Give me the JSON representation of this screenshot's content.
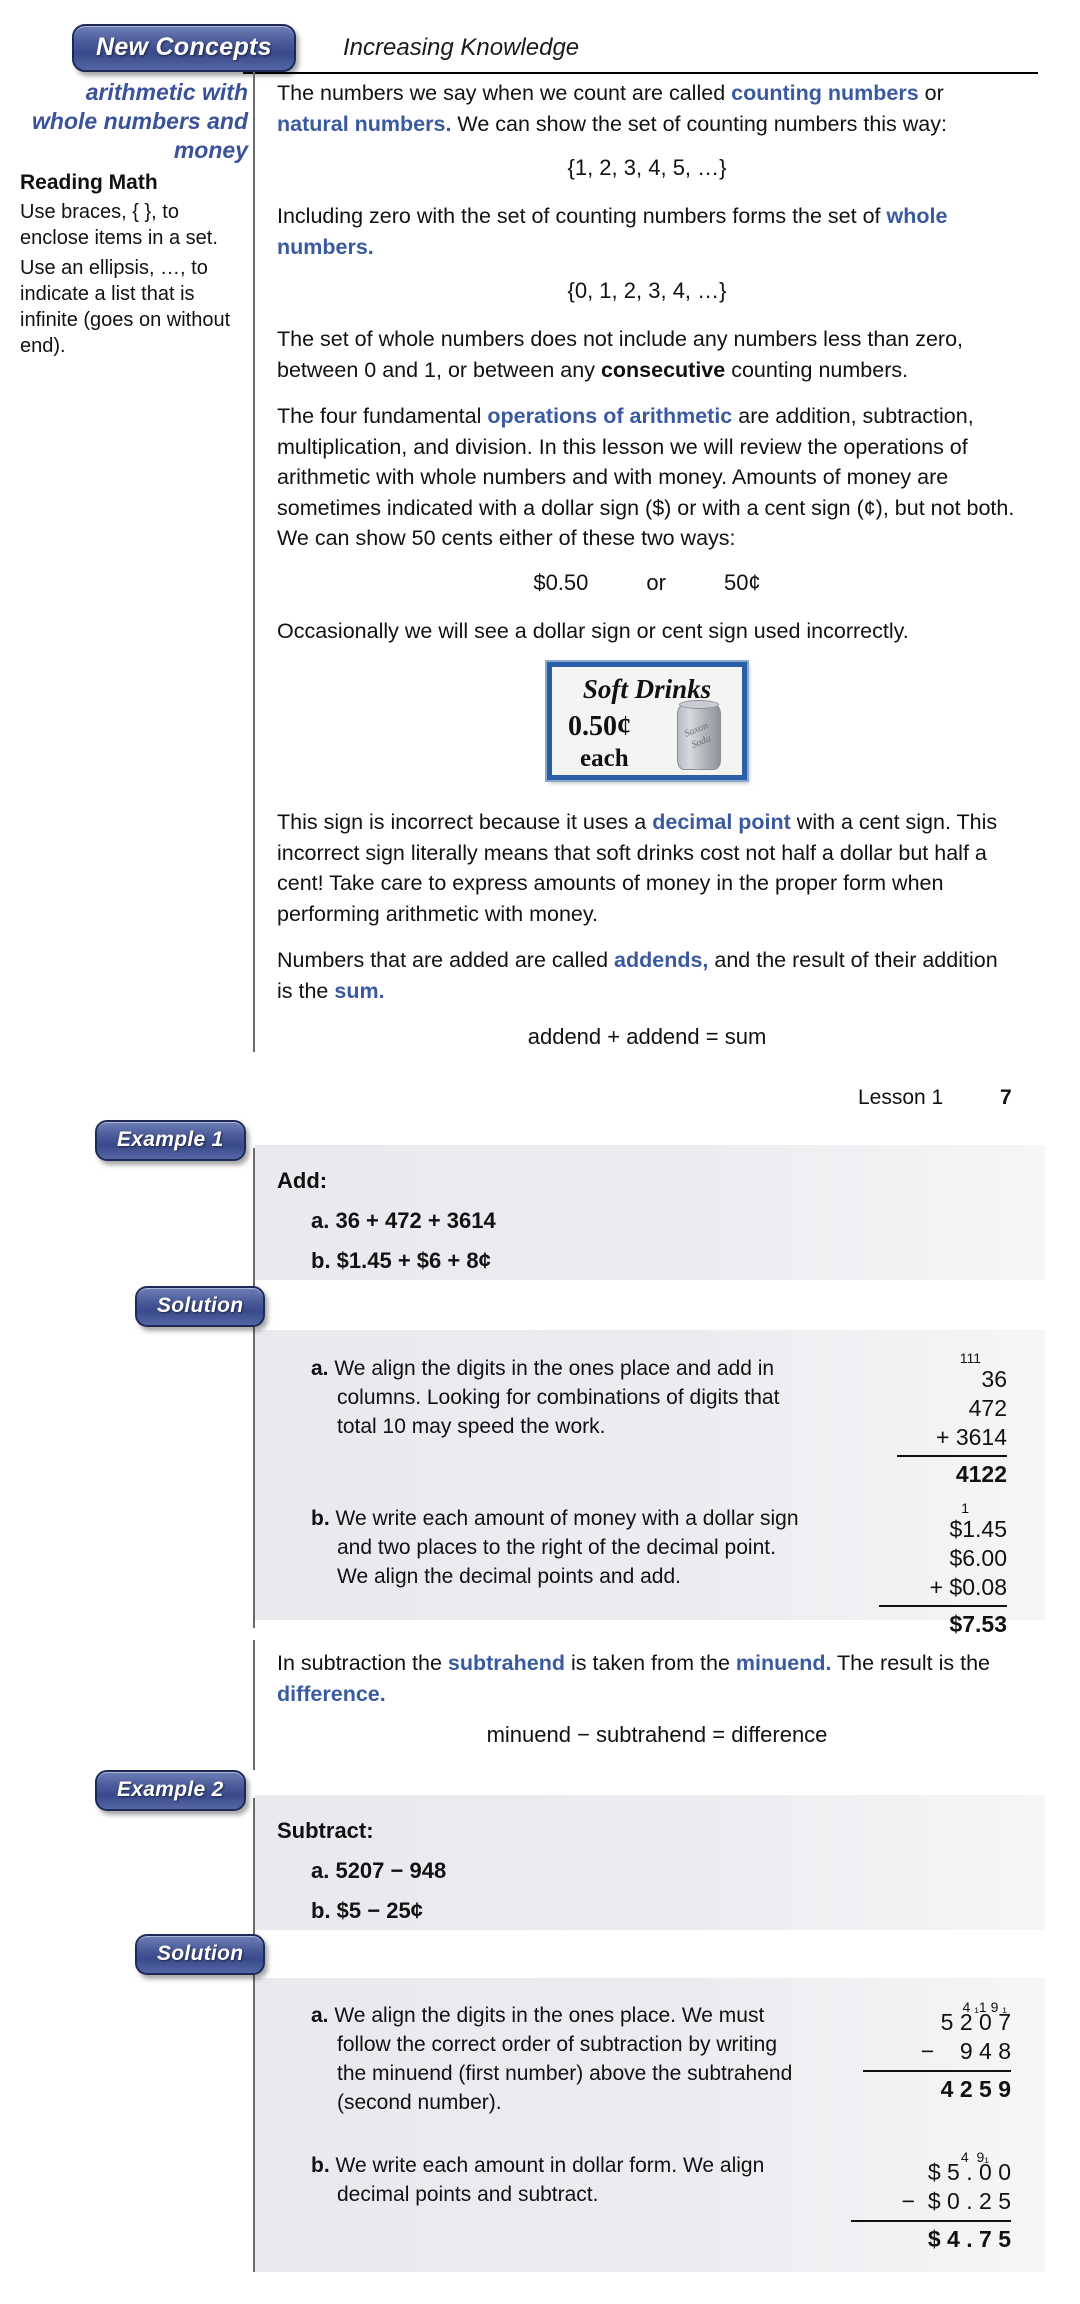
{
  "header": {
    "tab_label": "New Concepts",
    "subtitle": "Increasing Knowledge"
  },
  "sidebar": {
    "topic": "arithmetic with whole numbers and money",
    "reading_math_heading": "Reading Math",
    "reading_math_paragraphs": [
      "Use braces, { }, to enclose items in a set.",
      "Use an ellipsis, …, to indicate a list that is infinite (goes on without end)."
    ]
  },
  "body": {
    "p1_a": "The numbers we say when we count are called ",
    "p1_kw1": "counting numbers",
    "p1_b": " or ",
    "p1_kw2": "natural numbers.",
    "p1_c": " We can show the set of counting numbers this way:",
    "set_counting": "{1, 2, 3, 4, 5, …}",
    "p2_a": "Including zero with the set of counting numbers forms the set of ",
    "p2_kw": "whole numbers.",
    "set_whole": "{0, 1, 2, 3, 4, …}",
    "p3_a": "The set of whole numbers does not include any numbers less than zero, between 0 and 1, or between any ",
    "p3_bold": "consecutive",
    "p3_b": " counting numbers.",
    "p4_a": "The four fundamental ",
    "p4_kw": "operations of arithmetic",
    "p4_b": " are addition, subtraction, multiplication, and division. In this lesson we will review the operations of arithmetic with whole numbers and with money. Amounts of money are sometimes indicated with a dollar sign ($) or with a cent sign (¢), but not both. We can show 50 cents either of these two ways:",
    "money_left": "$0.50",
    "money_or": "or",
    "money_right": "50¢",
    "p5": "Occasionally we will see a dollar sign or cent sign used incorrectly.",
    "sign": {
      "title": "Soft Drinks",
      "price": "0.50¢",
      "each": "each",
      "can_label": "Saxon Soda"
    },
    "p6_a": "This sign is incorrect because it uses a ",
    "p6_kw": "decimal point",
    "p6_b": " with a cent sign. This incorrect sign literally means that soft drinks cost not half a dollar but half a cent! Take care to express amounts of money in the proper form when performing arithmetic with money.",
    "p7_a": "Numbers that are added are called ",
    "p7_kw1": "addends,",
    "p7_b": " and the result of their addition is the ",
    "p7_kw2": "sum.",
    "formula_add": "addend + addend = sum"
  },
  "footer": {
    "lesson_label": "Lesson 1",
    "page_number": "7"
  },
  "example1": {
    "tab_label": "Example 1",
    "solution_tab_label": "Solution",
    "heading": "Add:",
    "items": [
      "a. 36 + 472 + 3614",
      "b. $1.45 + $6 + 8¢"
    ],
    "solutions": [
      {
        "label": "a.",
        "text": "We align the digits in the ones place and add in columns. Looking for combinations of digits that total 10 may speed the work.",
        "work": {
          "carry": "111",
          "rows": [
            "36",
            "472"
          ],
          "op_row": "+ 3614",
          "total": "4122"
        }
      },
      {
        "label": "b.",
        "text": "We write each amount of money with a dollar sign and two places to the right of the decimal point. We align the decimal points and add.",
        "work": {
          "carry": "1",
          "rows": [
            "$1.45",
            "$6.00"
          ],
          "op_row": "+ $0.08",
          "total": "$7.53"
        }
      }
    ]
  },
  "interlude": {
    "text_a": "In subtraction the ",
    "kw1": "subtrahend",
    "text_b": " is taken from the ",
    "kw2": "minuend.",
    "text_c": " The result is the ",
    "kw3": "difference.",
    "formula": "minuend − subtrahend = difference"
  },
  "example2": {
    "tab_label": "Example 2",
    "solution_tab_label": "Solution",
    "heading": "Subtract:",
    "items": [
      "a. 5207 − 948",
      "b. $5 − 25¢"
    ],
    "solutions": [
      {
        "label": "a.",
        "text": "We align the digits in the ones place. We must follow the correct order of subtraction by writing the minuend (first number) above the subtrahend (second number).",
        "work": {
          "carry_digits": "4 ₁1 9 ₁",
          "minuend": "5 2 0 7",
          "op_row": "−    9 4 8",
          "total": "4 2 5 9"
        }
      },
      {
        "label": "b.",
        "text": "We write each amount in dollar form. We align decimal points and subtract.",
        "work": {
          "carry_digits": "4  9₁",
          "minuend": "$ 5 . 0 0",
          "op_row": "−  $ 0 . 2 5",
          "total": "$ 4 . 7 5"
        }
      }
    ]
  },
  "colors": {
    "keyword_blue": "#3a5aa0",
    "topic_blue": "#39529a",
    "banner_dark": "#394a8b",
    "sign_border": "#2a5fa8",
    "shade_bg": "#ececf0"
  }
}
